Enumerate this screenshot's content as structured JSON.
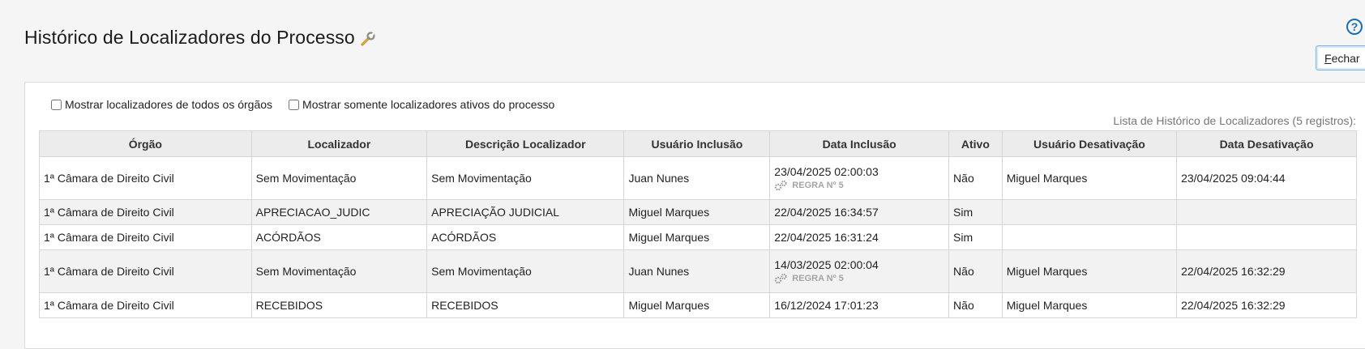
{
  "header": {
    "title": "Histórico de Localizadores do Processo",
    "help_symbol": "?",
    "close_label_first": "F",
    "close_label_rest": "echar"
  },
  "filters": {
    "all_organs_label": "Mostrar localizadores de todos os órgãos",
    "only_active_label": "Mostrar somente localizadores ativos do processo"
  },
  "table": {
    "caption": "Lista de Histórico de Localizadores (5 registros):",
    "columns": [
      "Órgão",
      "Localizador",
      "Descrição Localizador",
      "Usuário Inclusão",
      "Data Inclusão",
      "Ativo",
      "Usuário Desativação",
      "Data Desativação"
    ],
    "rows": [
      {
        "orgao": "1ª Câmara de Direito Civil",
        "localizador": "Sem Movimentação",
        "descricao": "Sem Movimentação",
        "usuario_inclusao": "Juan Nunes",
        "data_inclusao": "23/04/2025 02:00:03",
        "regra": "REGRA Nº 5",
        "ativo": "Não",
        "usuario_desativacao": "Miguel Marques",
        "data_desativacao": "23/04/2025 09:04:44"
      },
      {
        "orgao": "1ª Câmara de Direito Civil",
        "localizador": "APRECIACAO_JUDIC",
        "descricao": "APRECIAÇÃO JUDICIAL",
        "usuario_inclusao": "Miguel Marques",
        "data_inclusao": "22/04/2025 16:34:57",
        "regra": "",
        "ativo": "Sim",
        "usuario_desativacao": "",
        "data_desativacao": ""
      },
      {
        "orgao": "1ª Câmara de Direito Civil",
        "localizador": "ACÓRDÃOS",
        "descricao": "ACÓRDÃOS",
        "usuario_inclusao": "Miguel Marques",
        "data_inclusao": "22/04/2025 16:31:24",
        "regra": "",
        "ativo": "Sim",
        "usuario_desativacao": "",
        "data_desativacao": ""
      },
      {
        "orgao": "1ª Câmara de Direito Civil",
        "localizador": "Sem Movimentação",
        "descricao": "Sem Movimentação",
        "usuario_inclusao": "Juan Nunes",
        "data_inclusao": "14/03/2025 02:00:04",
        "regra": "REGRA Nº 5",
        "ativo": "Não",
        "usuario_desativacao": "Miguel Marques",
        "data_desativacao": "22/04/2025 16:32:29"
      },
      {
        "orgao": "1ª Câmara de Direito Civil",
        "localizador": "RECEBIDOS",
        "descricao": "RECEBIDOS",
        "usuario_inclusao": "Miguel Marques",
        "data_inclusao": "16/12/2024 17:01:23",
        "regra": "",
        "ativo": "Não",
        "usuario_desativacao": "Miguel Marques",
        "data_desativacao": "22/04/2025 16:32:29"
      }
    ]
  }
}
